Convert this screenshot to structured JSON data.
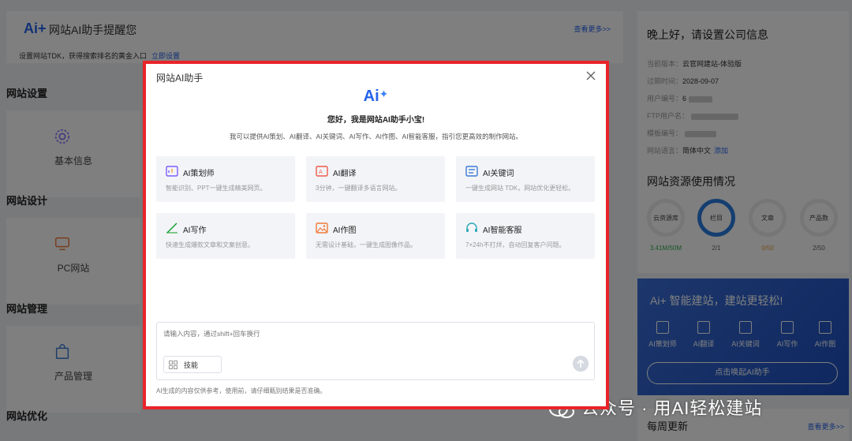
{
  "banner": {
    "logo": "Ai+",
    "title": "网站AI助手提醒您",
    "more": "查看更多>>",
    "subtitle": "设置网站TDK，获得搜索排名的黄金入口",
    "subtitle_link": "立即设置"
  },
  "sidebar": {
    "sections": [
      {
        "title": "网站设置",
        "card_label": "基本信息",
        "icon": "gear-icon"
      },
      {
        "title": "网站设计",
        "card_label": "PC网站",
        "icon": "monitor-icon"
      },
      {
        "title": "网站管理",
        "card_label": "产品管理",
        "icon": "bag-icon"
      },
      {
        "title": "网站优化"
      }
    ]
  },
  "right_panel": {
    "greeting": "晚上好，请设置公司信息",
    "lines": [
      {
        "label": "当前版本：",
        "value": "云官网建站-体验版"
      },
      {
        "label": "过期时间：",
        "value": "2028-09-07"
      },
      {
        "label": "用户编号：",
        "value": "6"
      },
      {
        "label": "FTP用户名：",
        "value": ""
      },
      {
        "label": "模板编号：",
        "value": ""
      },
      {
        "label": "网站语言：",
        "value": "简体中文",
        "link": "添加"
      }
    ],
    "resource_title": "网站资源使用情况",
    "resources": [
      {
        "name": "云资源库",
        "value": "3.41M/50M"
      },
      {
        "name": "栏目",
        "value": "2/1"
      },
      {
        "name": "文章",
        "value": "0/50"
      },
      {
        "name": "产品数",
        "value": "2/50"
      }
    ]
  },
  "promo": {
    "title": "Ai+ 智能建站，建站更轻松!",
    "items": [
      "AI策划师",
      "AI翻译",
      "AI关键词",
      "AI写作",
      "AI作图"
    ],
    "button": "点击唤起AI助手"
  },
  "weekly": {
    "title": "每周更新",
    "more": "查看更多>>"
  },
  "watermark": "公众号 · 用AI轻松建站",
  "modal": {
    "title": "网站AI助手",
    "logo": "Ai",
    "greeting": "您好，我是网站AI助手小宝!",
    "description": "我可以提供AI策划、AI翻译、AI关键词、AI写作、AI作图、AI智能客服，指引您更高效的制作网站。",
    "features": [
      {
        "name": "AI策划师",
        "desc": "智能识别、PPT一键生成精美网页。",
        "icon": "planner-icon",
        "color": "#7c5cff"
      },
      {
        "name": "AI翻译",
        "desc": "3分钟，一键翻译多语言网站。",
        "icon": "translate-icon",
        "color": "#f05a4a"
      },
      {
        "name": "AI关键词",
        "desc": "一键生成网站 TDK，网站优化更轻松。",
        "icon": "keyword-icon",
        "color": "#3a7bd5"
      },
      {
        "name": "AI写作",
        "desc": "快速生成爆款文章和文案创意。",
        "icon": "pen-icon",
        "color": "#2eaa46"
      },
      {
        "name": "AI作图",
        "desc": "无需设计基础，一键生成图像作品。",
        "icon": "image-icon",
        "color": "#f07a3a"
      },
      {
        "name": "AI智能客服",
        "desc": "7×24h不打烊，自动回复客户问题。",
        "icon": "headset-icon",
        "color": "#2aa8b8"
      }
    ],
    "input_placeholder": "请输入内容，通过shift+回车换行",
    "skill_label": "技能",
    "disclaimer": "AI生成的内容仅供参考，使用前，请仔细甄别结果是否准确。"
  }
}
